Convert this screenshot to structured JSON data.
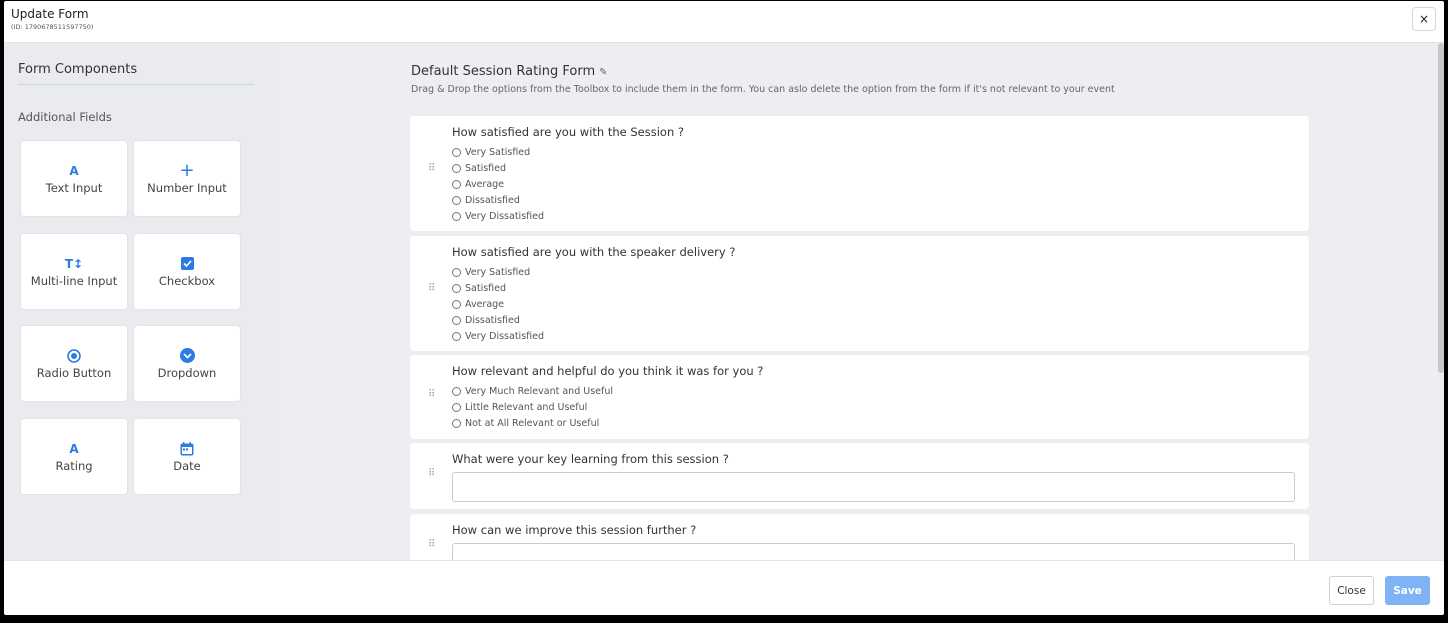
{
  "header": {
    "title": "Update Form",
    "id_text": "(ID: 1790678511597750)",
    "close_icon": "×"
  },
  "sidebar": {
    "title": "Form Components",
    "section": "Additional Fields",
    "tiles": [
      {
        "label": "Text Input",
        "icon": "text-icon"
      },
      {
        "label": "Number Input",
        "icon": "plus-icon"
      },
      {
        "label": "Multi-line Input",
        "icon": "text-height-icon"
      },
      {
        "label": "Checkbox",
        "icon": "checkbox-icon"
      },
      {
        "label": "Radio Button",
        "icon": "radio-icon"
      },
      {
        "label": "Dropdown",
        "icon": "chevron-circle-icon"
      },
      {
        "label": "Rating",
        "icon": "text-icon"
      },
      {
        "label": "Date",
        "icon": "calendar-icon"
      }
    ]
  },
  "form": {
    "title": "Default Session Rating Form",
    "description": "Drag & Drop the options from the Toolbox to include them in the form. You can aslo delete the option from the form if it's not relevant to your event",
    "questions": [
      {
        "text": "How satisfied are you with the Session ?",
        "options": [
          "Very Satisfied",
          "Satisfied",
          "Average",
          "Dissatisfied",
          "Very Dissatisfied"
        ]
      },
      {
        "text": "How satisfied are you with the speaker delivery ?",
        "options": [
          "Very Satisfied",
          "Satisfied",
          "Average",
          "Dissatisfied",
          "Very Dissatisfied"
        ]
      },
      {
        "text": "How relevant and helpful do you think it was for you ?",
        "options": [
          "Very Much Relevant and Useful",
          "Little Relevant and Useful",
          "Not at All Relevant or Useful"
        ]
      },
      {
        "text": "What were your key learning from this session ?"
      },
      {
        "text": "How can we improve this session further ?"
      }
    ]
  },
  "footer": {
    "close_label": "Close",
    "save_label": "Save"
  },
  "colors": {
    "accent": "#2c7be5",
    "save_button": "#7fb3f5",
    "sidebar_bg": "#e9ebef",
    "content_bg": "#eceef1"
  }
}
